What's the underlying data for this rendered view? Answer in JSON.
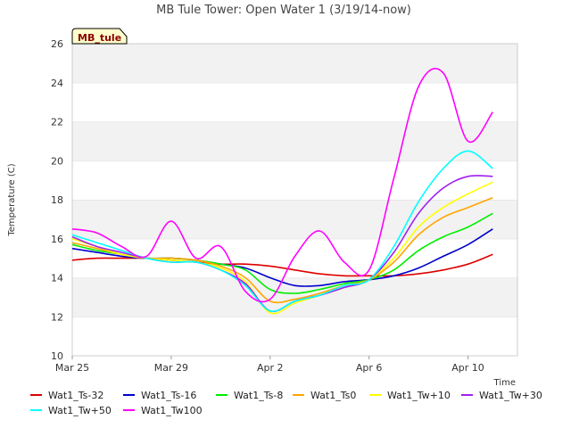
{
  "chart_data": {
    "type": "line",
    "title": "MB Tule Tower: Open Water 1 (3/19/14-now)",
    "xlabel": "Time",
    "ylabel": "Temperature (C)",
    "tag_label": "MB_tule",
    "ylim": [
      10,
      26
    ],
    "xlim": [
      "2014-03-25",
      "2014-04-12"
    ],
    "yticks": [
      10,
      12,
      14,
      16,
      18,
      20,
      22,
      24,
      26
    ],
    "xticks": [
      {
        "label": "Mar 25",
        "value": "2014-03-25"
      },
      {
        "label": "Mar 29",
        "value": "2014-03-29"
      },
      {
        "label": "Apr 2",
        "value": "2014-04-02"
      },
      {
        "label": "Apr 6",
        "value": "2014-04-06"
      },
      {
        "label": "Apr 10",
        "value": "2014-04-10"
      }
    ],
    "grid": "horizontal alternating bands",
    "legend_position": "bottom",
    "x": [
      "2014-03-25",
      "2014-03-26",
      "2014-03-27",
      "2014-03-28",
      "2014-03-29",
      "2014-03-30",
      "2014-03-31",
      "2014-04-01",
      "2014-04-02",
      "2014-04-03",
      "2014-04-04",
      "2014-04-05",
      "2014-04-06",
      "2014-04-07",
      "2014-04-08",
      "2014-04-09",
      "2014-04-10",
      "2014-04-11"
    ],
    "series": [
      {
        "name": "Wat1_Ts-32",
        "color": "#dd0000",
        "values": [
          14.9,
          15.0,
          15.0,
          15.0,
          14.9,
          14.8,
          14.7,
          14.7,
          14.6,
          14.4,
          14.2,
          14.1,
          14.1,
          14.1,
          14.2,
          14.4,
          14.7,
          15.2
        ]
      },
      {
        "name": "Wat1_Ts-16",
        "color": "#0000cc",
        "values": [
          15.5,
          15.3,
          15.1,
          15.0,
          15.0,
          14.9,
          14.7,
          14.5,
          14.0,
          13.6,
          13.6,
          13.8,
          13.9,
          14.1,
          14.5,
          15.1,
          15.7,
          16.5
        ]
      },
      {
        "name": "Wat1_Ts-8",
        "color": "#00ee00",
        "values": [
          15.7,
          15.4,
          15.2,
          15.0,
          15.0,
          14.9,
          14.7,
          14.4,
          13.4,
          13.2,
          13.4,
          13.7,
          13.9,
          14.4,
          15.4,
          16.1,
          16.6,
          17.3
        ]
      },
      {
        "name": "Wat1_Ts0",
        "color": "#ffa500",
        "values": [
          15.8,
          15.5,
          15.2,
          15.0,
          15.0,
          14.9,
          14.6,
          14.0,
          12.8,
          12.9,
          13.2,
          13.6,
          13.9,
          14.8,
          16.2,
          17.1,
          17.6,
          18.1
        ]
      },
      {
        "name": "Wat1_Tw+10",
        "color": "#ffff00",
        "values": [
          16.0,
          15.6,
          15.2,
          15.0,
          14.9,
          14.8,
          14.5,
          13.8,
          12.2,
          12.7,
          13.1,
          13.5,
          13.9,
          15.0,
          16.6,
          17.6,
          18.3,
          18.9
        ]
      },
      {
        "name": "Wat1_Tw+30",
        "color": "#a020f0",
        "values": [
          16.1,
          15.6,
          15.3,
          15.0,
          14.8,
          14.8,
          14.4,
          13.7,
          12.3,
          12.8,
          13.1,
          13.5,
          13.9,
          15.3,
          17.3,
          18.6,
          19.2,
          19.2
        ]
      },
      {
        "name": "Wat1_Tw+50",
        "color": "#00ffff",
        "values": [
          16.2,
          15.8,
          15.4,
          15.0,
          14.8,
          14.8,
          14.4,
          13.6,
          12.3,
          12.8,
          13.1,
          13.6,
          13.9,
          15.6,
          17.9,
          19.6,
          20.5,
          19.6
        ]
      },
      {
        "name": "Wat1_Tw100",
        "color": "#ff00ff",
        "values": [
          16.5,
          16.3,
          15.6,
          15.1,
          16.9,
          15.0,
          15.6,
          13.3,
          12.9,
          15.1,
          16.4,
          14.8,
          14.4,
          19.1,
          23.8,
          24.5,
          21.0,
          22.5
        ]
      }
    ]
  }
}
